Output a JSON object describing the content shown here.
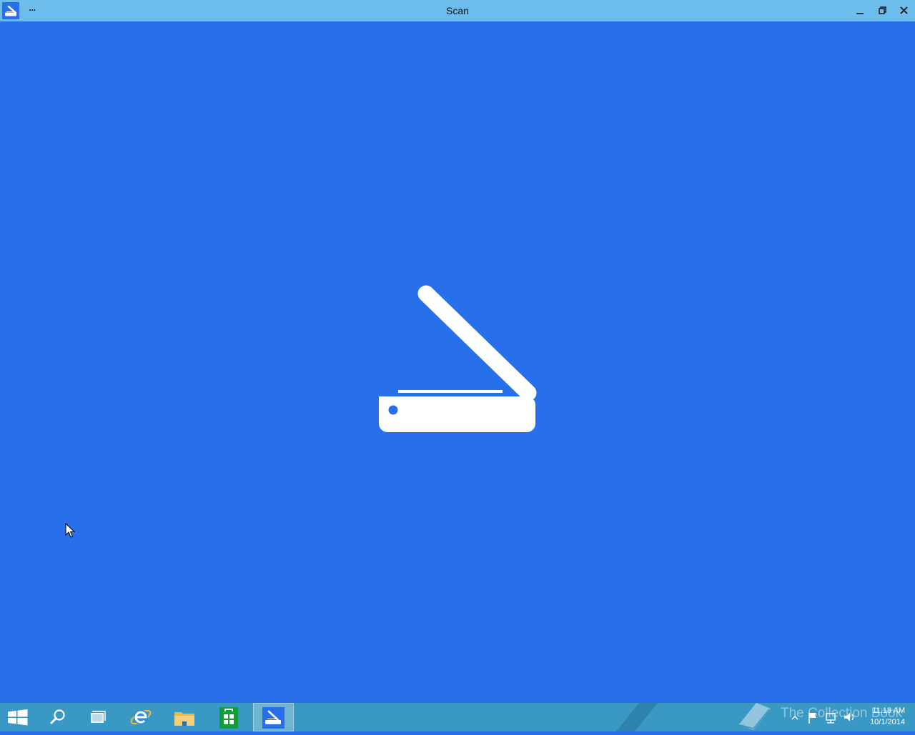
{
  "window": {
    "title": "Scan",
    "more_label": "···",
    "app_icon": "scan-app-icon",
    "controls": {
      "minimize_icon": "minimize-icon",
      "maximize_icon": "restore-icon",
      "close_icon": "close-icon"
    }
  },
  "content": {
    "illustration": "scanner-icon",
    "background_color": "#2870ea"
  },
  "taskbar": {
    "background_color": "#3a98c4",
    "items": [
      {
        "name": "start",
        "icon": "windows-logo-icon"
      },
      {
        "name": "search",
        "icon": "search-icon"
      },
      {
        "name": "task-view",
        "icon": "task-view-icon"
      },
      {
        "name": "internet-explorer",
        "icon": "internet-explorer-icon"
      },
      {
        "name": "file-explorer",
        "icon": "folder-icon"
      },
      {
        "name": "store",
        "icon": "store-bag-icon"
      },
      {
        "name": "scan",
        "icon": "scan-app-icon",
        "active": true
      }
    ],
    "tray": {
      "icons": [
        "chevron-up-icon",
        "flag-icon",
        "network-icon",
        "volume-icon"
      ],
      "time": "11:18 AM",
      "date": "10/1/2014"
    },
    "watermark": {
      "text": "The Collection Book",
      "icon": "book-icon"
    }
  }
}
